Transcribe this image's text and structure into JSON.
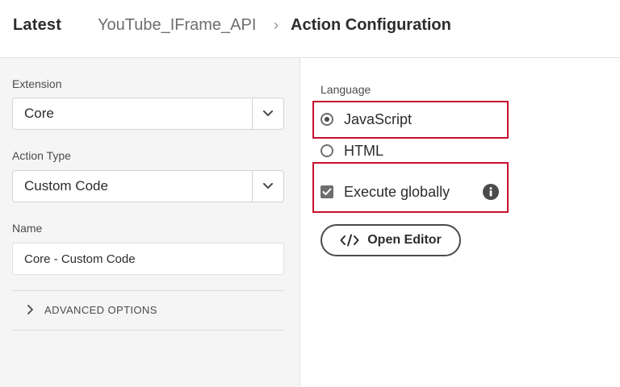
{
  "header": {
    "latest": "Latest",
    "breadcrumb": "YouTube_IFrame_API",
    "separator": "›",
    "title": "Action Configuration"
  },
  "left": {
    "extension": {
      "label": "Extension",
      "value": "Core"
    },
    "action_type": {
      "label": "Action Type",
      "value": "Custom Code"
    },
    "name": {
      "label": "Name",
      "value": "Core - Custom Code"
    },
    "advanced": {
      "label": "ADVANCED OPTIONS",
      "icon": "chevron-right-icon"
    }
  },
  "right": {
    "language_label": "Language",
    "options": [
      {
        "label": "JavaScript",
        "selected": true
      },
      {
        "label": "HTML",
        "selected": false
      }
    ],
    "execute_globally": {
      "label": "Execute globally",
      "checked": true,
      "icon": "info-icon"
    },
    "open_editor": {
      "label": "Open Editor",
      "icon": "code-icon"
    }
  },
  "colors": {
    "highlight": "#c8102e",
    "panel_bg": "#f5f5f5",
    "text": "#2c2c2c"
  }
}
